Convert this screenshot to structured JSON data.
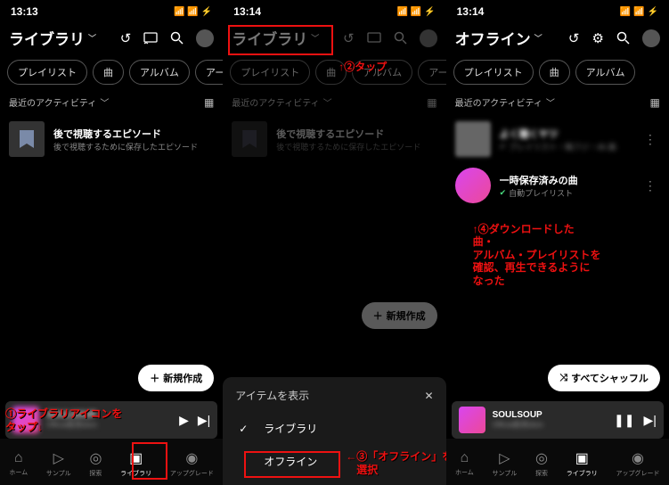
{
  "screens": [
    {
      "time": "13:13",
      "title": "ライブラリ",
      "icons": [
        "history",
        "cast",
        "search",
        "avatar"
      ],
      "chips": [
        "プレイリスト",
        "曲",
        "アルバム",
        "アーティス"
      ],
      "section": "最近のアクティビティ",
      "items": [
        {
          "title": "後で視聴するエピソード",
          "sub": "後で視聴するために保存したエピソード",
          "thumb": "bookmark"
        }
      ],
      "newbtn": "新規作成",
      "now": {
        "title": "SOULSOUP",
        "sub": "Official髭男dism"
      },
      "tabs": [
        "ホーム",
        "サンプル",
        "探索",
        "ライブラリ",
        "アップグレード"
      ],
      "anno1": "①ライブラリアイコンを\nタップ↓"
    },
    {
      "time": "13:14",
      "title": "ライブラリ",
      "chips": [
        "プレイリスト",
        "曲",
        "アルバム",
        "アーティス"
      ],
      "section": "最近のアクティビティ",
      "items": [
        {
          "title": "後で視聴するエピソード",
          "sub": "後で視聴するために保存したエピソード",
          "thumb": "bookmark"
        }
      ],
      "newbtn": "新規作成",
      "sheet": {
        "heading": "アイテムを表示",
        "opt1": "ライブラリ",
        "opt2": "オフライン"
      },
      "anno_top": "↑②タップ",
      "anno_mid": "←③「オフライン」を\n　選択"
    },
    {
      "time": "13:14",
      "title": "オフライン",
      "icons": [
        "history",
        "gear",
        "search",
        "avatar"
      ],
      "chips": [
        "プレイリスト",
        "曲",
        "アルバム"
      ],
      "section": "最近のアクティビティ",
      "items": [
        {
          "title": "よく聴くヤツ",
          "sub": "プレイリスト・梅フジ・46 曲",
          "thumb": "gray",
          "blurred": true
        },
        {
          "title": "一時保存済みの曲",
          "sub": "自動プレイリスト",
          "thumb": "pink",
          "check": true
        }
      ],
      "shuffle": "すべてシャッフル",
      "now": {
        "title": "SOULSOUP",
        "sub": "Official髭男dism"
      },
      "tabs": [
        "ホーム",
        "サンプル",
        "探索",
        "ライブラリ",
        "アップグレード"
      ],
      "anno4": "↑④ダウンロードした\n曲・\nアルバム・プレイリストを\n確認、再生できるように\nなった"
    }
  ]
}
